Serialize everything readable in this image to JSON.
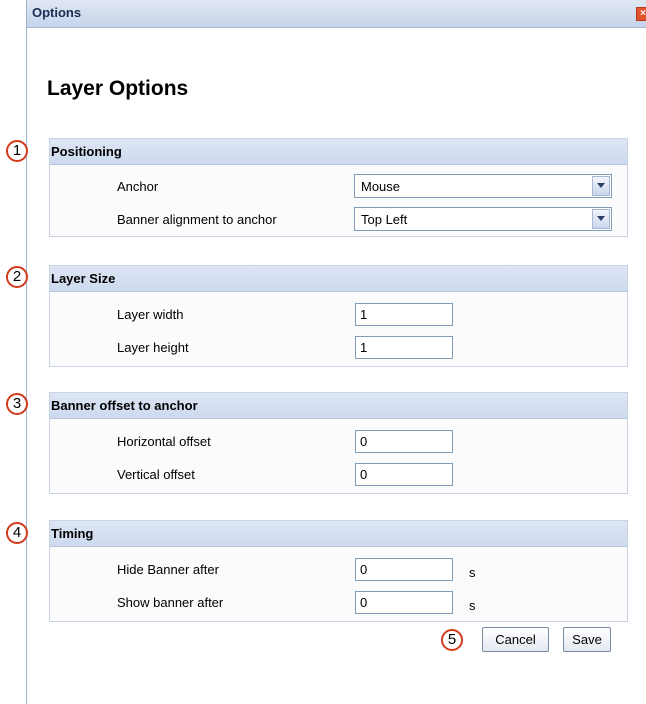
{
  "window": {
    "title": "Options",
    "close_icon": "close-icon",
    "close_color": "#e2532c"
  },
  "page": {
    "heading": "Layer Options"
  },
  "sections": {
    "positioning": {
      "number": "1",
      "title": "Positioning",
      "anchor": {
        "label": "Anchor",
        "value": "Mouse"
      },
      "alignment": {
        "label": "Banner alignment to anchor",
        "value": "Top Left"
      }
    },
    "layer_size": {
      "number": "2",
      "title": "Layer Size",
      "width": {
        "label": "Layer width",
        "value": "1"
      },
      "height": {
        "label": "Layer height",
        "value": "1"
      }
    },
    "offset": {
      "number": "3",
      "title": "Banner offset to anchor",
      "horizontal": {
        "label": "Horizontal offset",
        "value": "0"
      },
      "vertical": {
        "label": "Vertical offset",
        "value": "0"
      }
    },
    "timing": {
      "number": "4",
      "title": "Timing",
      "hide": {
        "label": "Hide Banner after",
        "value": "0",
        "unit": "s"
      },
      "show": {
        "label": "Show banner after",
        "value": "0",
        "unit": "s"
      }
    }
  },
  "footer": {
    "number": "5",
    "cancel_label": "Cancel",
    "save_label": "Save"
  },
  "colors": {
    "callout_ring": "#d23a1c",
    "section_header": "#ccd9ee"
  }
}
